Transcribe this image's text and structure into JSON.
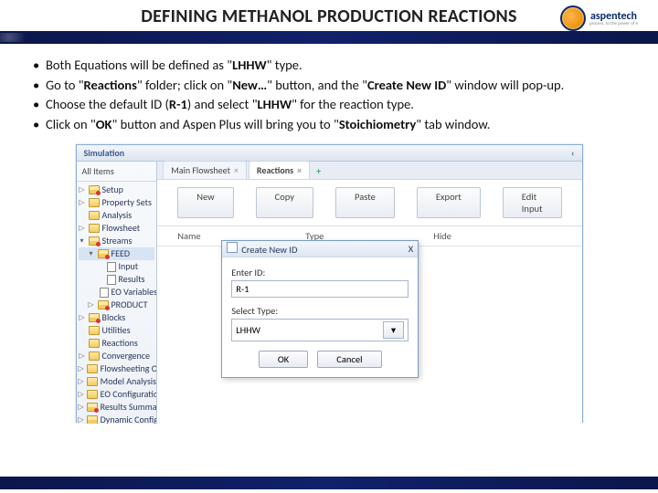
{
  "slide": {
    "title": "DEFINING METHANOL PRODUCTION REACTIONS"
  },
  "logo": {
    "brand": "aspentech",
    "tag": "process, to the power of e"
  },
  "bullets": [
    "Both Equations will be defined as \"<b>LHHW</b>\" type.",
    "Go to \"<b>Reactions</b>\" folder; click on \"<b>New…</b>\" button, and the \"<b>Create New ID</b>\" window will pop-up.",
    "Choose the default ID (<b>R-1</b>) and select \"<b>LHHW</b>\" for the reaction type.",
    "Click on \"<b>OK</b>\" button and Aspen Plus will bring you to \"<b>Stoichiometry</b>\" tab window."
  ],
  "app": {
    "pane_title": "Simulation",
    "side_header": "All Items",
    "tree": {
      "setup": "Setup",
      "propsets": "Property Sets",
      "analysis": "Analysis",
      "flowsheet": "Flowsheet",
      "streams": "Streams",
      "feed": "FEED",
      "input": "Input",
      "results": "Results",
      "eovars": "EO Variables",
      "product": "PRODUCT",
      "blocks": "Blocks",
      "utilities": "Utilities",
      "reactions": "Reactions",
      "convergence": "Convergence",
      "flowopts": "Flowsheeting Options",
      "modelanalysis": "Model Analysis Tools",
      "eoconfig": "EO Configuration",
      "resultssum": "Results Summary",
      "dynconfig": "Dynamic Configuration"
    },
    "tabs": {
      "flowsheet": "Main Flowsheet",
      "reactions": "Reactions"
    },
    "toolbar": {
      "new": "New",
      "copy": "Copy",
      "paste": "Paste",
      "export": "Export",
      "editinput": "Edit Input"
    },
    "grid": {
      "name": "Name",
      "type": "Type",
      "hide": "Hide"
    },
    "dialog": {
      "title": "Create New ID",
      "enter_id": "Enter ID:",
      "id_value": "R-1",
      "select_type": "Select Type:",
      "type_value": "LHHW",
      "ok": "OK",
      "cancel": "Cancel",
      "close": "X"
    }
  }
}
